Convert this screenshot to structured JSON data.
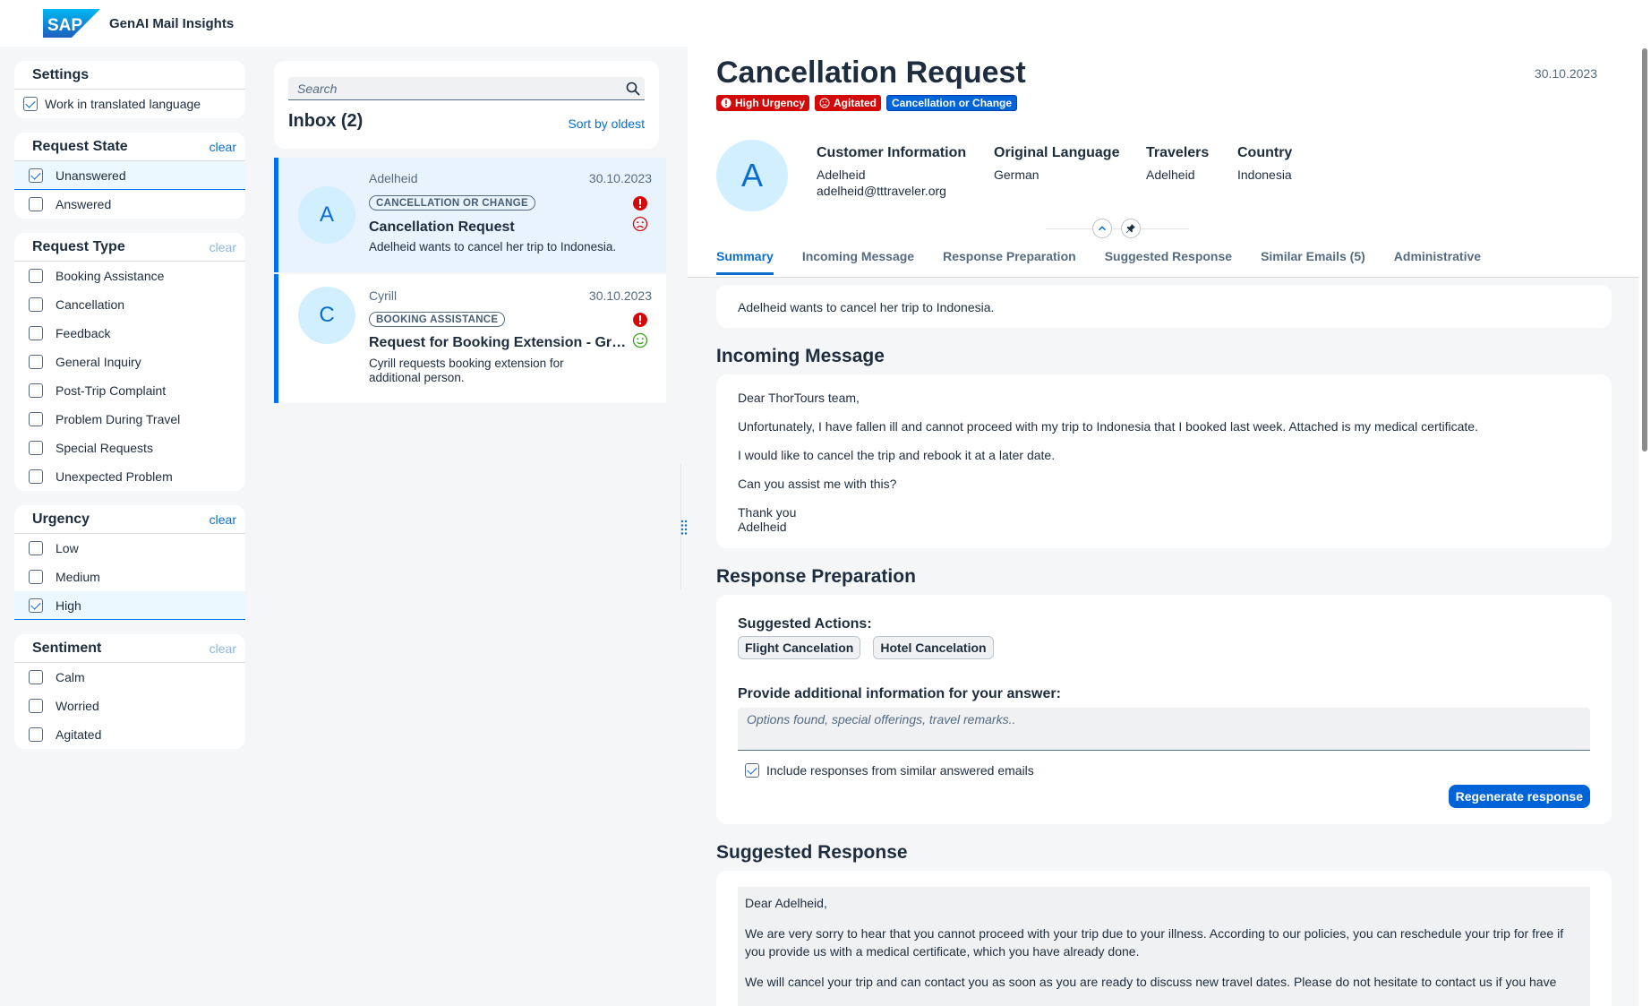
{
  "shell": {
    "app_title": "GenAI Mail Insights",
    "logo_text": "SAP"
  },
  "filters": {
    "settings": {
      "title": "Settings",
      "translated_label": "Work in translated language"
    },
    "request_state": {
      "title": "Request State",
      "clear": "clear",
      "options": [
        "Unanswered",
        "Answered"
      ]
    },
    "request_type": {
      "title": "Request Type",
      "clear": "clear",
      "options": [
        "Booking Assistance",
        "Cancellation",
        "Feedback",
        "General Inquiry",
        "Post-Trip Complaint",
        "Problem During Travel",
        "Special Requests",
        "Unexpected Problem"
      ]
    },
    "urgency": {
      "title": "Urgency",
      "clear": "clear",
      "options": [
        "Low",
        "Medium",
        "High"
      ]
    },
    "sentiment": {
      "title": "Sentiment",
      "clear": "clear",
      "options": [
        "Calm",
        "Worried",
        "Agitated"
      ]
    }
  },
  "inbox": {
    "search_placeholder": "Search",
    "title": "Inbox (2)",
    "sort_label": "Sort by oldest",
    "mails": [
      {
        "initial": "A",
        "from": "Adelheid",
        "date": "30.10.2023",
        "tag": "CANCELLATION OR CHANGE",
        "subject": "Cancellation Request",
        "preview": "Adelheid wants to cancel her trip to Indonesia."
      },
      {
        "initial": "C",
        "from": "Cyrill",
        "date": "30.10.2023",
        "tag": "BOOKING ASSISTANCE",
        "subject": "Request for Booking Extension - Group Trip",
        "preview": "Cyrill requests booking extension for additional person."
      }
    ]
  },
  "detail": {
    "title": "Cancellation Request",
    "date": "30.10.2023",
    "badges": {
      "urgency": "High Urgency",
      "sentiment": "Agitated",
      "category": "Cancellation or Change"
    },
    "avatar_initial": "A",
    "customer": {
      "heading": "Customer Information",
      "name": "Adelheid",
      "email": "adelheid@tttraveler.org"
    },
    "language": {
      "heading": "Original Language",
      "value": "German"
    },
    "travelers": {
      "heading": "Travelers",
      "value": "Adelheid"
    },
    "country": {
      "heading": "Country",
      "value": "Indonesia"
    },
    "tabs": [
      "Summary",
      "Incoming Message",
      "Response Preparation",
      "Suggested Response",
      "Similar Emails (5)",
      "Administrative"
    ],
    "summary": "Adelheid wants to cancel her trip to Indonesia.",
    "incoming": {
      "title": "Incoming Message",
      "greeting": "Dear ThorTours team,",
      "p1": "Unfortunately, I have fallen ill and cannot proceed with my trip to Indonesia that I booked last week. Attached is my medical certificate.",
      "p2": "I would like to cancel the trip and rebook it at a later date.",
      "p3": "Can you assist me with this?",
      "closing": "Thank you",
      "signature": "Adelheid"
    },
    "preparation": {
      "title": "Response Preparation",
      "actions_label": "Suggested Actions:",
      "actions": [
        "Flight Cancelation",
        "Hotel Cancelation"
      ],
      "additional_label": "Provide additional information for your answer:",
      "additional_placeholder": "Options found, special offerings, travel remarks..",
      "include_label": "Include responses from similar answered emails",
      "regenerate": "Regenerate response"
    },
    "suggested": {
      "title": "Suggested Response",
      "greeting": "Dear Adelheid,",
      "p1": "We are very sorry to hear that you cannot proceed with your trip due to your illness. According to our policies, you can reschedule your trip for free if you provide us with a medical certificate, which you have already done.",
      "p2": "We will cancel your trip and can contact you as soon as you are ready to discuss new travel dates. Please do not hesitate to contact us if you have"
    }
  },
  "colors": {
    "accent": "#0a6ed1",
    "urgent": "#d20a0a",
    "positive": "#36a41d"
  }
}
